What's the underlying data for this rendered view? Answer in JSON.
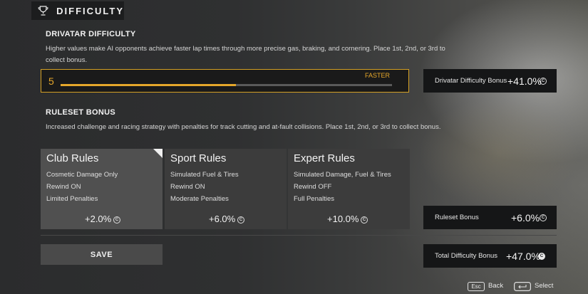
{
  "header": {
    "title": "DIFFICULTY",
    "icon": "trophy-icon"
  },
  "drivatar": {
    "heading": "DRIVATAR DIFFICULTY",
    "description_line1": "Higher values make AI opponents achieve faster lap times through more precise gas, braking, and cornering. Place 1st, 2nd, or 3rd to",
    "description_line2": "collect bonus.",
    "slider": {
      "value": "5",
      "label": "FASTER",
      "fill_fraction": 0.53,
      "accent": "#e5a72b"
    },
    "bonus_label": "Drivatar Difficulty Bonus",
    "bonus_value": "+41.0%"
  },
  "ruleset": {
    "heading": "RULESET BONUS",
    "description": "Increased challenge and racing strategy with penalties for track cutting and at-fault collisions. Place 1st, 2nd, or 3rd to collect bonus.",
    "cards": [
      {
        "title": "Club Rules",
        "lines": [
          "Cosmetic Damage Only",
          "Rewind ON",
          "Limited Penalties"
        ],
        "bonus": "+2.0%",
        "selected": true
      },
      {
        "title": "Sport Rules",
        "lines": [
          "Simulated Fuel & Tires",
          "Rewind ON",
          "Moderate Penalties"
        ],
        "bonus": "+6.0%",
        "selected": false
      },
      {
        "title": "Expert Rules",
        "lines": [
          "Simulated Damage, Fuel & Tires",
          "Rewind OFF",
          "Full Penalties"
        ],
        "bonus": "+10.0%",
        "selected": false
      }
    ],
    "bonus_label": "Ruleset Bonus",
    "bonus_value": "+6.0%"
  },
  "save_label": "SAVE",
  "total": {
    "label": "Total Difficulty Bonus",
    "value": "+47.0%"
  },
  "hints": {
    "back_key": "Esc",
    "back_label": "Back",
    "select_key_icon": "enter-key-icon",
    "select_label": "Select"
  },
  "credit_symbol": "C"
}
